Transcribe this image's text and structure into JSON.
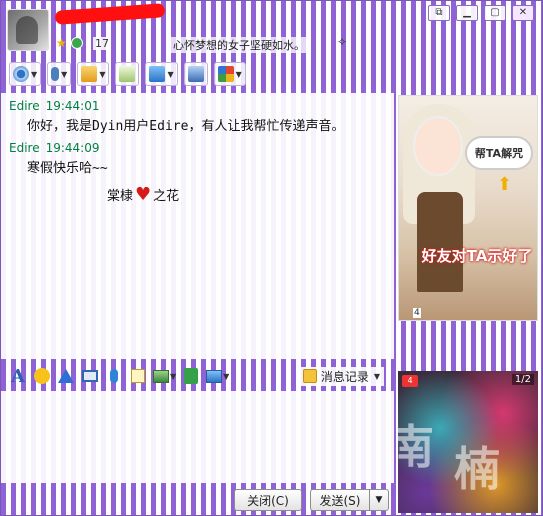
{
  "title_bar": {
    "level": "17",
    "signature": "心怀梦想的女子坚硬如水。",
    "signature_extra": "✧",
    "controls": [
      "⧉",
      "▁",
      "▢",
      "✕"
    ]
  },
  "toolbar": {
    "items": [
      {
        "icon": "camera-icon",
        "has_dropdown": true
      },
      {
        "icon": "microphone-icon",
        "has_dropdown": true
      },
      {
        "icon": "file-transfer-icon",
        "has_dropdown": true
      },
      {
        "icon": "add-app-icon",
        "has_dropdown": false
      },
      {
        "icon": "remote-screen-icon",
        "has_dropdown": true
      },
      {
        "icon": "share-screen-icon",
        "has_dropdown": false
      },
      {
        "icon": "apps-grid-icon",
        "has_dropdown": true
      }
    ]
  },
  "messages": [
    {
      "name": "Edire",
      "time": "19:44:01",
      "text": "你好，我是Dyin用户Edire，有人让我帮忙传递声音。"
    },
    {
      "name": "Edire",
      "time": "19:44:09",
      "text": "寒假快乐哈~~"
    }
  ],
  "gift": {
    "prefix": "棠棣",
    "suffix": "之花"
  },
  "ad": {
    "bubble": "帮TA解咒",
    "headline": "好友对TA示好了",
    "page": "4"
  },
  "input_toolbar": {
    "history_label": "消息记录"
  },
  "input": {
    "value": ""
  },
  "buttons": {
    "close": "关闭(C)",
    "send": "发送(S)",
    "send_menu": "▼"
  },
  "show_panel": {
    "page": "1/2",
    "level": "4",
    "chars": [
      "南",
      "楠"
    ]
  },
  "colors": {
    "stripe": "#8f63d6",
    "timestamp": "#008040",
    "heart": "#d81919"
  }
}
